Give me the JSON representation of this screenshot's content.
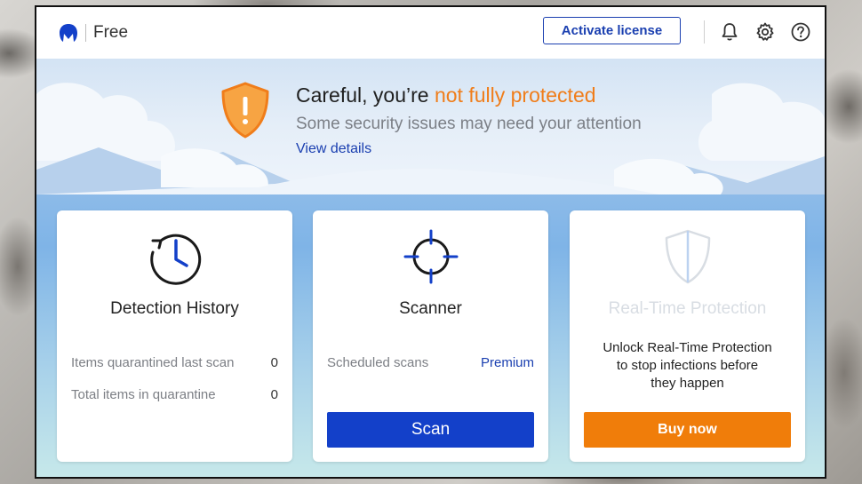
{
  "app": {
    "edition": "Free"
  },
  "header": {
    "activate_label": "Activate license"
  },
  "icons": {
    "logo": "malwarebytes-logo",
    "bell": "bell-icon",
    "gear": "gear-icon",
    "help": "help-icon",
    "warning_shield": "warning-shield-icon",
    "history": "clock-history-icon",
    "scanner": "crosshair-icon",
    "realtime": "shield-icon"
  },
  "status": {
    "headline_prefix": "Careful, you’re ",
    "headline_highlight": "not fully protected",
    "subline": "Some security issues may need your attention",
    "details_link": "View details"
  },
  "cards": {
    "history": {
      "title": "Detection History",
      "rows": [
        {
          "label": "Items quarantined last scan",
          "value": "0"
        },
        {
          "label": "Total items in quarantine",
          "value": "0"
        }
      ]
    },
    "scanner": {
      "title": "Scanner",
      "scheduled_label": "Scheduled scans",
      "scheduled_value": "Premium",
      "button": "Scan"
    },
    "realtime": {
      "title": "Real-Time Protection",
      "upsell_lines": [
        "Unlock Real-Time Protection",
        "to stop infections before",
        "they happen"
      ],
      "button": "Buy now"
    }
  },
  "colors": {
    "brand_blue": "#1340c9",
    "link_blue": "#1a3fb0",
    "warning_orange": "#f07d1a",
    "buy_orange": "#f07d0a"
  }
}
